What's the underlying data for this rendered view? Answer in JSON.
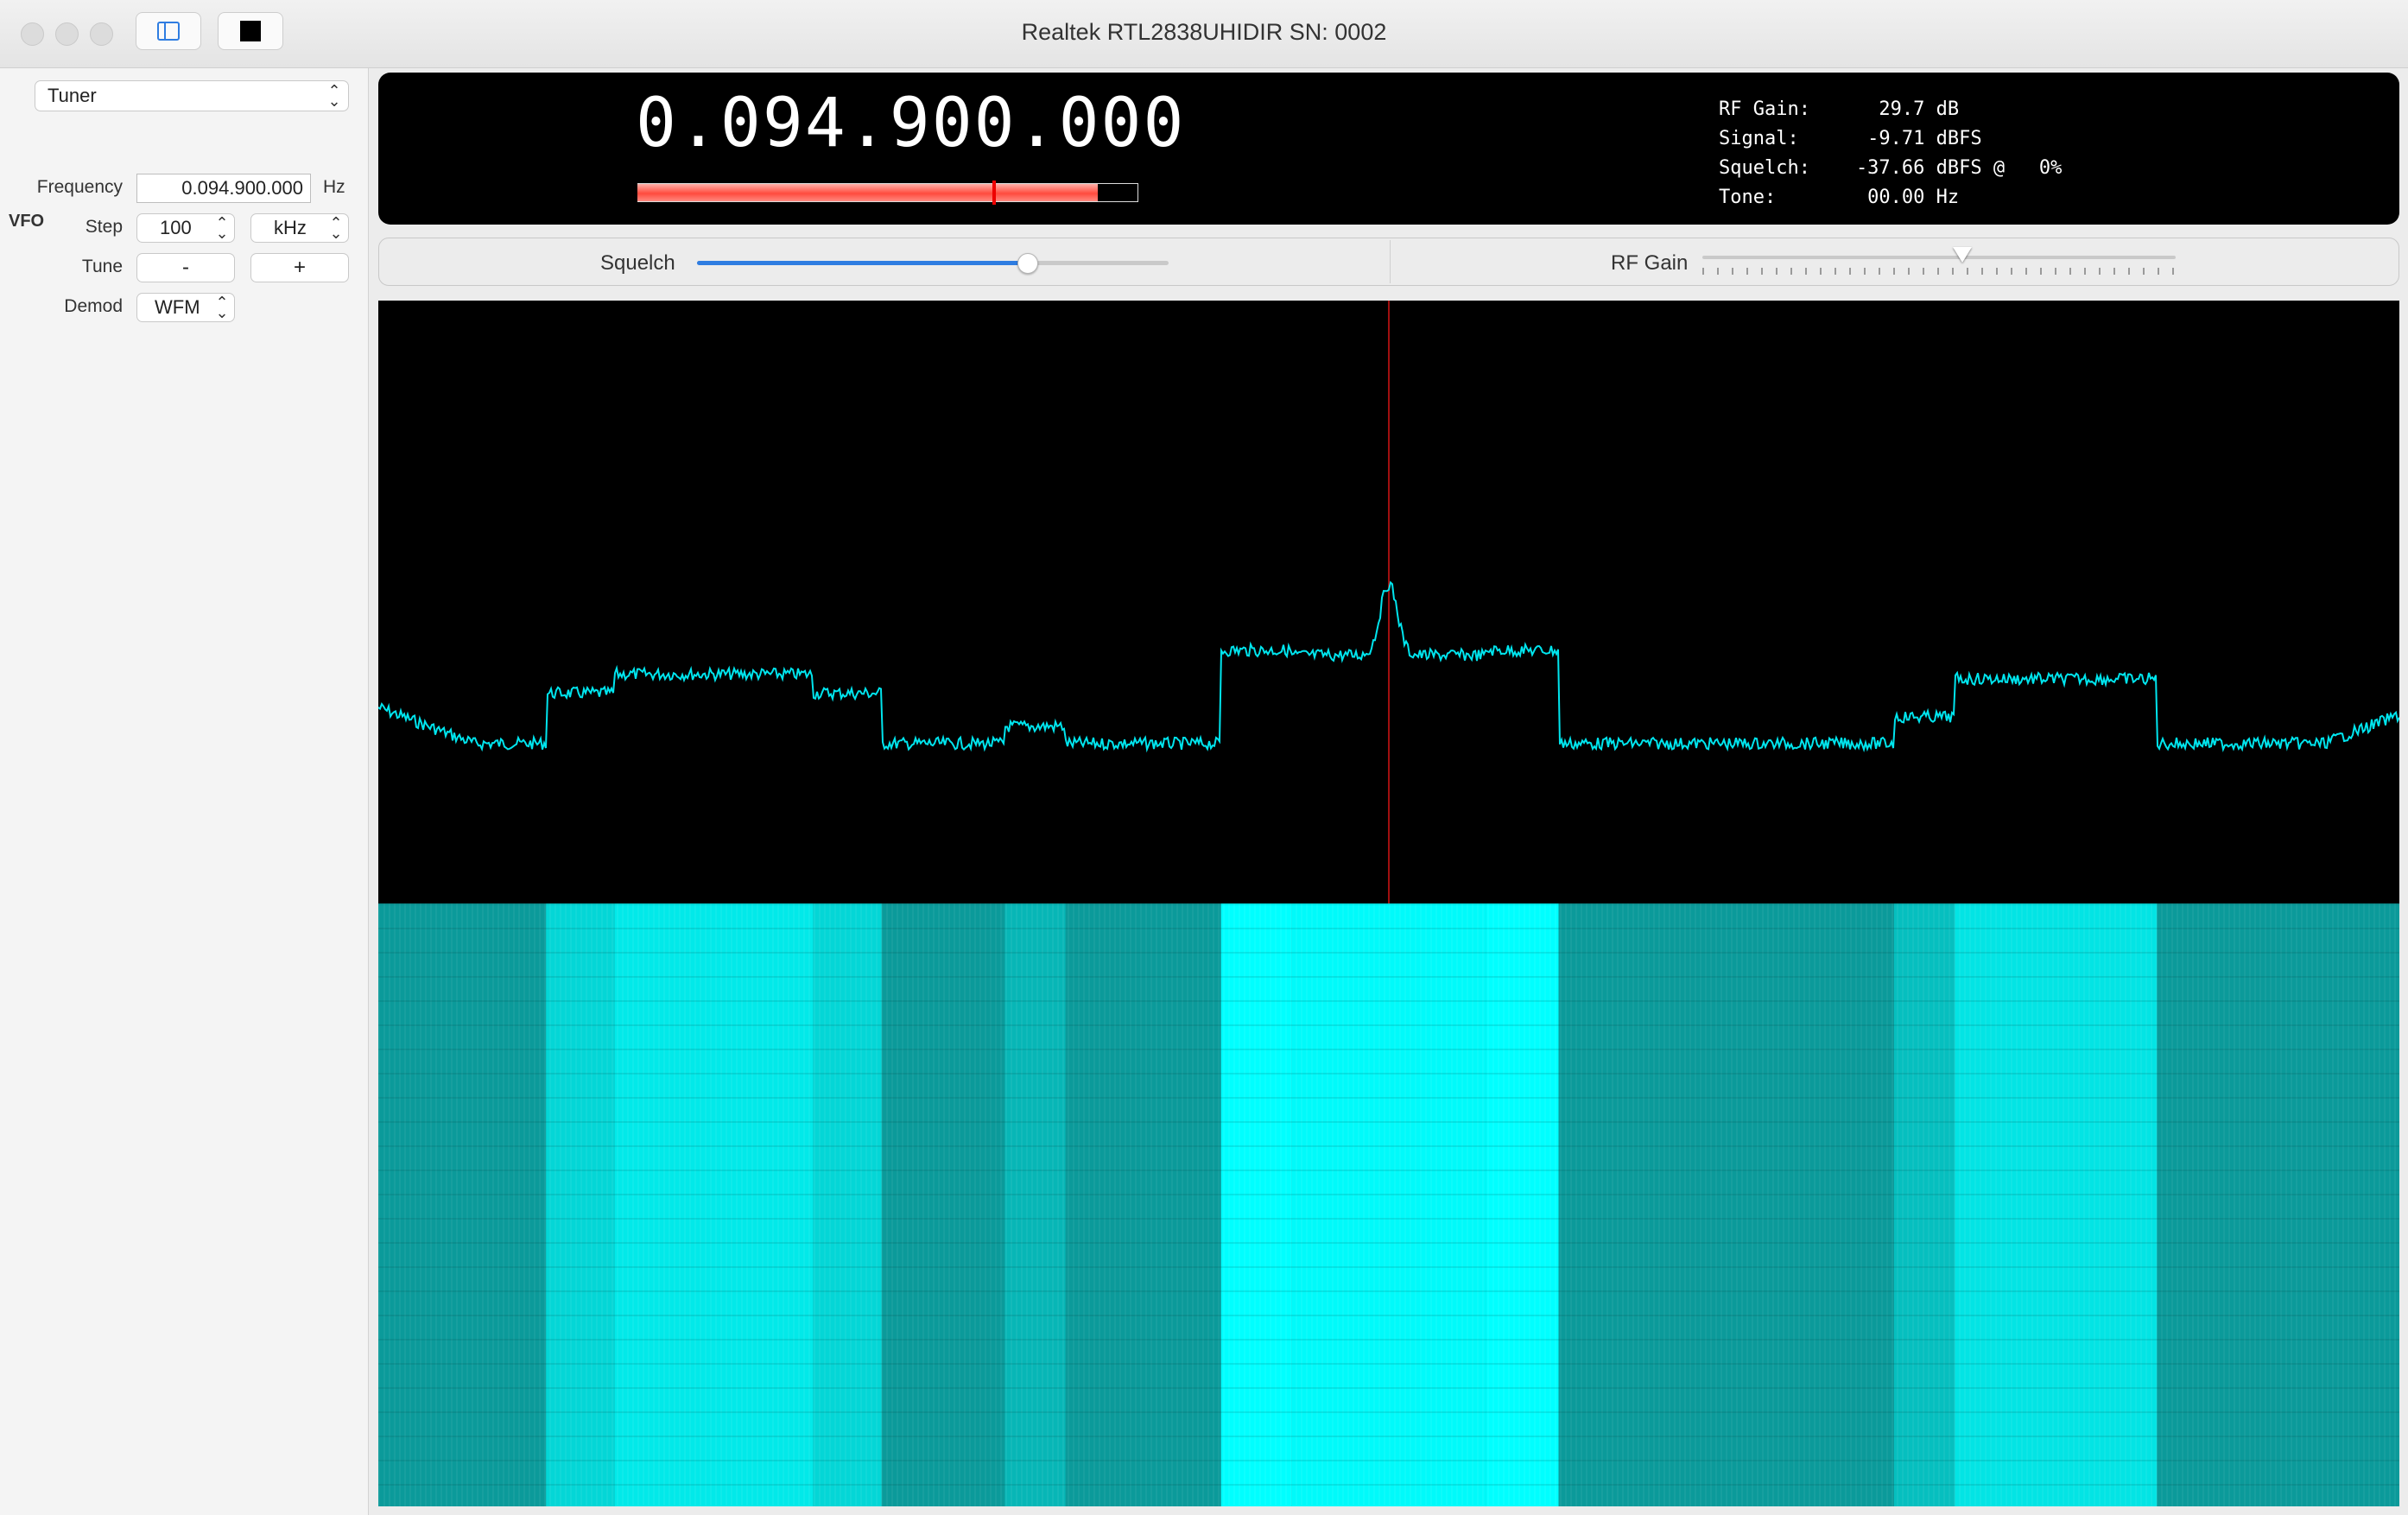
{
  "window": {
    "title": "Realtek RTL2838UHIDIR SN: 0002"
  },
  "toolbar": {
    "sidebar_toggle_icon": "sidebar-icon",
    "stop_icon": "stop-icon"
  },
  "sidebar": {
    "panel_select": "Tuner",
    "section_title": "VFO",
    "frequency": {
      "label": "Frequency",
      "value": "0.094.900.000",
      "unit": "Hz"
    },
    "step": {
      "label": "Step",
      "value": "100",
      "unit": "kHz"
    },
    "tune": {
      "label": "Tune",
      "minus": "-",
      "plus": "+"
    },
    "demod": {
      "label": "Demod",
      "value": "WFM"
    }
  },
  "display": {
    "frequency": "0.094.900.000",
    "signal_meter_fraction": 0.92,
    "squelch_marker_fraction": 0.71,
    "stats": {
      "rf_gain": "RF Gain:      29.7 dB",
      "signal": "Signal:      -9.71 dBFS",
      "squelch": "Squelch:    -37.66 dBFS @   0%",
      "tone": "Tone:        00.00 Hz"
    }
  },
  "controls": {
    "squelch": {
      "label": "Squelch",
      "value_fraction": 0.7
    },
    "rf_gain": {
      "label": "RF Gain",
      "value_fraction": 0.55
    }
  },
  "colors": {
    "trace": "#00e5ee",
    "center_marker": "#a01010",
    "waterfall_base": "#0b9a9a",
    "waterfall_hot": "#00ffff",
    "meter": "#ff4b3e",
    "accent": "#2f7de1"
  },
  "spectrum": {
    "center_fraction": 0.5,
    "bands": [
      {
        "from": 0.083,
        "to": 0.117,
        "level": 0.55
      },
      {
        "from": 0.117,
        "to": 0.215,
        "level": 0.75
      },
      {
        "from": 0.215,
        "to": 0.249,
        "level": 0.55
      },
      {
        "from": 0.31,
        "to": 0.34,
        "level": 0.2
      },
      {
        "from": 0.417,
        "to": 0.452,
        "level": 1.0
      },
      {
        "from": 0.452,
        "to": 0.548,
        "level": 0.95
      },
      {
        "from": 0.548,
        "to": 0.584,
        "level": 1.0
      },
      {
        "from": 0.75,
        "to": 0.78,
        "level": 0.3
      },
      {
        "from": 0.78,
        "to": 0.88,
        "level": 0.7
      }
    ]
  }
}
